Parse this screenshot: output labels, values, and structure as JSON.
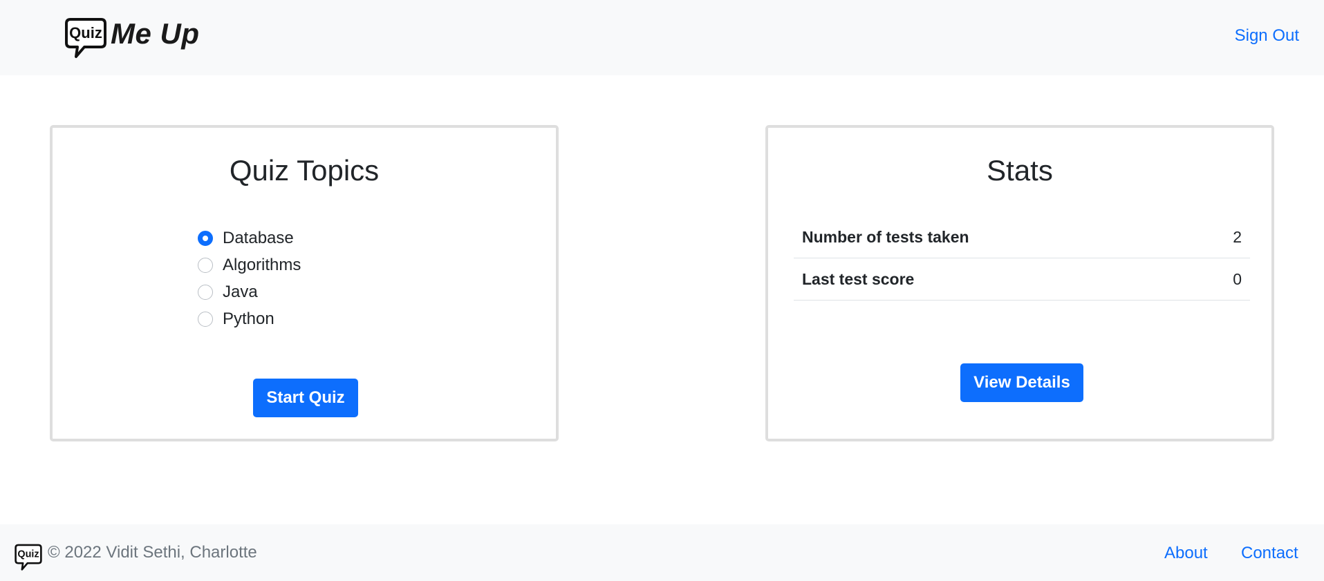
{
  "header": {
    "logo_text": "Quiz",
    "brand_text": "Me Up",
    "sign_out": "Sign Out"
  },
  "topics_card": {
    "title": "Quiz Topics",
    "options": [
      {
        "label": "Database",
        "checked": true
      },
      {
        "label": "Algorithms",
        "checked": false
      },
      {
        "label": "Java",
        "checked": false
      },
      {
        "label": "Python",
        "checked": false
      }
    ],
    "start_button": "Start Quiz"
  },
  "stats_card": {
    "title": "Stats",
    "rows": [
      {
        "label": "Number of tests taken",
        "value": "2"
      },
      {
        "label": "Last test score",
        "value": "0"
      }
    ],
    "details_button": "View Details"
  },
  "footer": {
    "logo_text": "Quiz",
    "copyright": "© 2022 Vidit Sethi, Charlotte",
    "links": [
      "About",
      "Contact"
    ]
  },
  "colors": {
    "accent": "#0d6efd",
    "bar_bg": "#f8f9fa",
    "card_border": "#dedede",
    "muted_text": "#6c757d"
  },
  "icons": {
    "brand_logo": "speech-bubble-icon",
    "footer_logo": "speech-bubble-icon"
  }
}
